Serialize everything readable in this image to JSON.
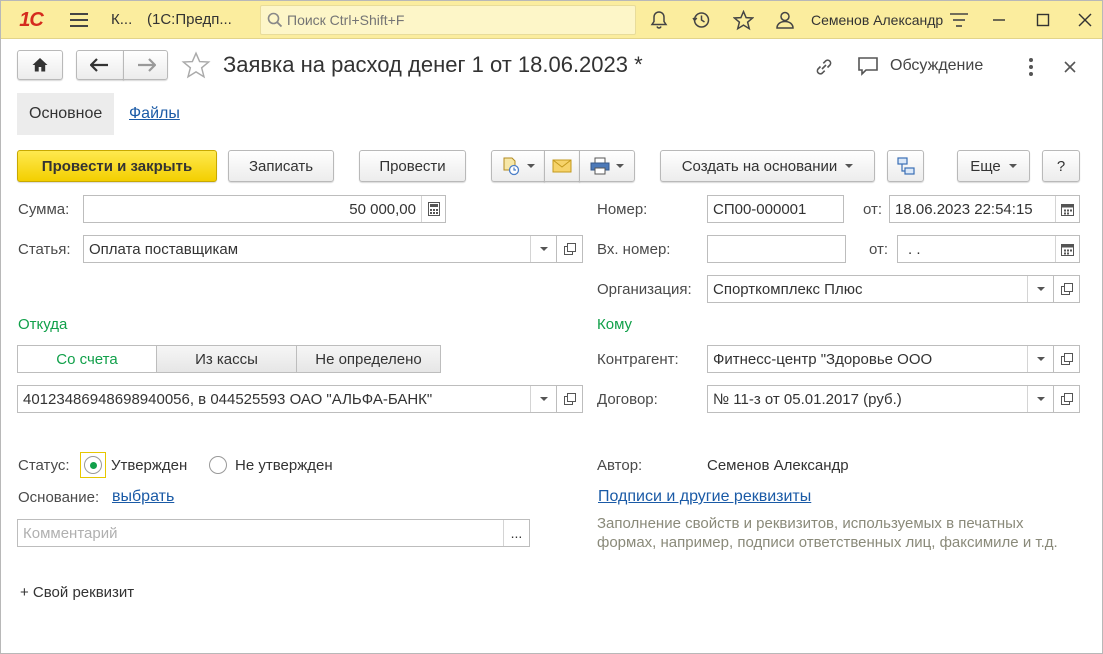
{
  "titlebar": {
    "logo": "1С",
    "short_title": "К...",
    "app_title": "(1С:Предп...",
    "search_placeholder": "Поиск Ctrl+Shift+F",
    "user": "Семенов Александр"
  },
  "header": {
    "title": "Заявка на расход денег 1 от 18.06.2023 *",
    "discussion_label": "Обсуждение"
  },
  "tabs": [
    {
      "label": "Основное",
      "active": true
    },
    {
      "label": "Файлы",
      "active": false
    }
  ],
  "toolbar": {
    "post_close": "Провести и закрыть",
    "save": "Записать",
    "post": "Провести",
    "create_based": "Создать на основании",
    "more": "Еще",
    "help": "?"
  },
  "form": {
    "sum_label": "Сумма:",
    "sum_value": "50 000,00",
    "article_label": "Статья:",
    "article_value": "Оплата поставщикам",
    "number_label": "Номер:",
    "number_value": "СП00-000001",
    "date_from_label": "от:",
    "date_value": "18.06.2023 22:54:15",
    "in_number_label": "Вх. номер:",
    "in_number_value": "",
    "in_date_label": "от:",
    "in_date_value": " .  .",
    "org_label": "Организация:",
    "org_value": "Спорткомплекс Плюс",
    "from_section": "Откуда",
    "to_section": "Кому",
    "source_options": [
      "Со счета",
      "Из кассы",
      "Не определено"
    ],
    "source_selected": "Со счета",
    "account_value": "40123486948698940056, в 044525593 ОАО \"АЛЬФА-БАНК\"",
    "counterparty_label": "Контрагент:",
    "counterparty_value": "Фитнесс-центр \"Здоровье ООО",
    "contract_label": "Договор:",
    "contract_value": "№ 11-з от 05.01.2017 (руб.)",
    "status_label": "Статус:",
    "status_options": [
      "Утвержден",
      "Не утвержден"
    ],
    "status_selected": "Утвержден",
    "author_label": "Автор:",
    "author_value": "Семенов Александр",
    "basis_label": "Основание:",
    "basis_link": "выбрать",
    "signatures_link": "Подписи и другие реквизиты",
    "signatures_hint": "Заполнение свойств и реквизитов, используемых в печатных формах, например, подписи ответственных лиц, факсимиле и т.д.",
    "comment_placeholder": "Комментарий",
    "comment_button": "...",
    "custom_attr": "+ Свой реквизит"
  },
  "colors": {
    "titlebar_bg": "#fbed9e",
    "primary_button": "#f3cf00",
    "section_green": "#11a04a",
    "link_blue": "#1a5aa6"
  }
}
